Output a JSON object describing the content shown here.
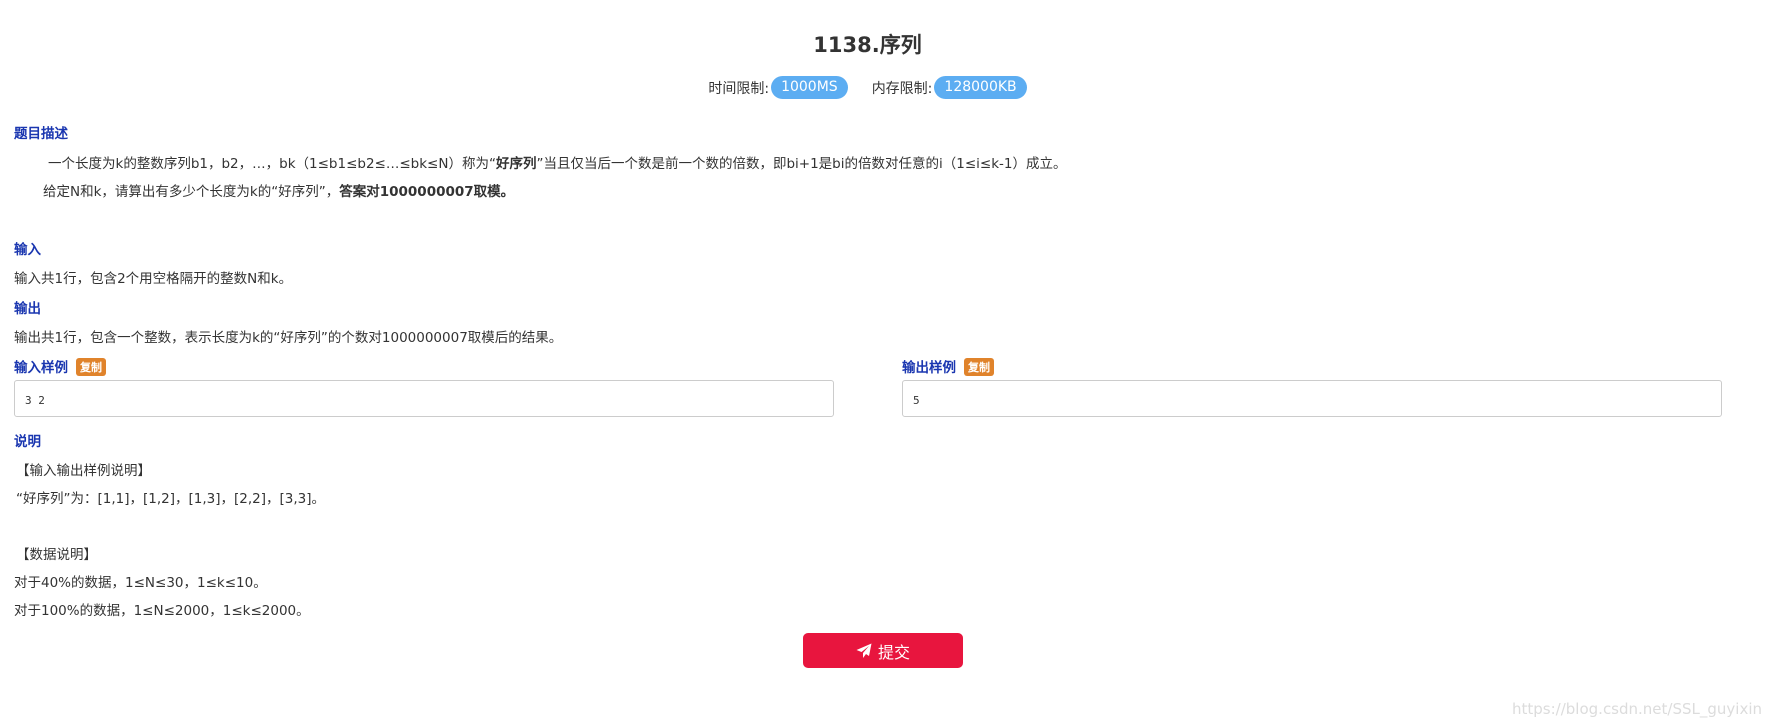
{
  "problem": {
    "title": "1138.序列",
    "time_limit_label": "时间限制:",
    "time_limit_value": "1000MS",
    "memory_limit_label": "内存限制:",
    "memory_limit_value": "128000KB"
  },
  "description": {
    "heading": "题目描述",
    "line1_pre": "一个长度为k的整数序列b1，b2，…，bk（1≤b1≤b2≤…≤bk≤N）称为“",
    "line1_bold": "好序列",
    "line1_post": "”当且仅当后一个数是前一个数的倍数，即bi+1是bi的倍数对任意的i（1≤i≤k-1）成立。",
    "line2_pre": "给定N和k，请算出有多少个长度为k的“好序列”，",
    "line2_bold": "答案对1000000007取模。"
  },
  "input": {
    "heading": "输入",
    "text": "输入共1行，包含2个用空格隔开的整数N和k。"
  },
  "output": {
    "heading": "输出",
    "text": "输出共1行，包含一个整数，表示长度为k的“好序列”的个数对1000000007取模后的结果。"
  },
  "sample_input": {
    "heading": "输入样例",
    "copy_label": "复制",
    "value": "3 2"
  },
  "sample_output": {
    "heading": "输出样例",
    "copy_label": "复制",
    "value": "5"
  },
  "notes": {
    "heading": "说明",
    "line1": "【输入输出样例说明】",
    "line2": "“好序列”为：[1,1]，[1,2]，[1,3]，[2,2]，[3,3]。",
    "line3": "【数据说明】",
    "line4": "对于40%的数据，1≤N≤30，1≤k≤10。",
    "line5": "对于100%的数据，1≤N≤2000，1≤k≤2000。"
  },
  "submit": {
    "label": "提交",
    "icon": "paper-plane-icon"
  },
  "watermark": "https://blog.csdn.net/SSL_guyixin",
  "colors": {
    "section_heading": "#1a36b0",
    "limit_pill": "#5cadf2",
    "copy_badge": "#e0832b",
    "submit_button": "#e8153e"
  }
}
